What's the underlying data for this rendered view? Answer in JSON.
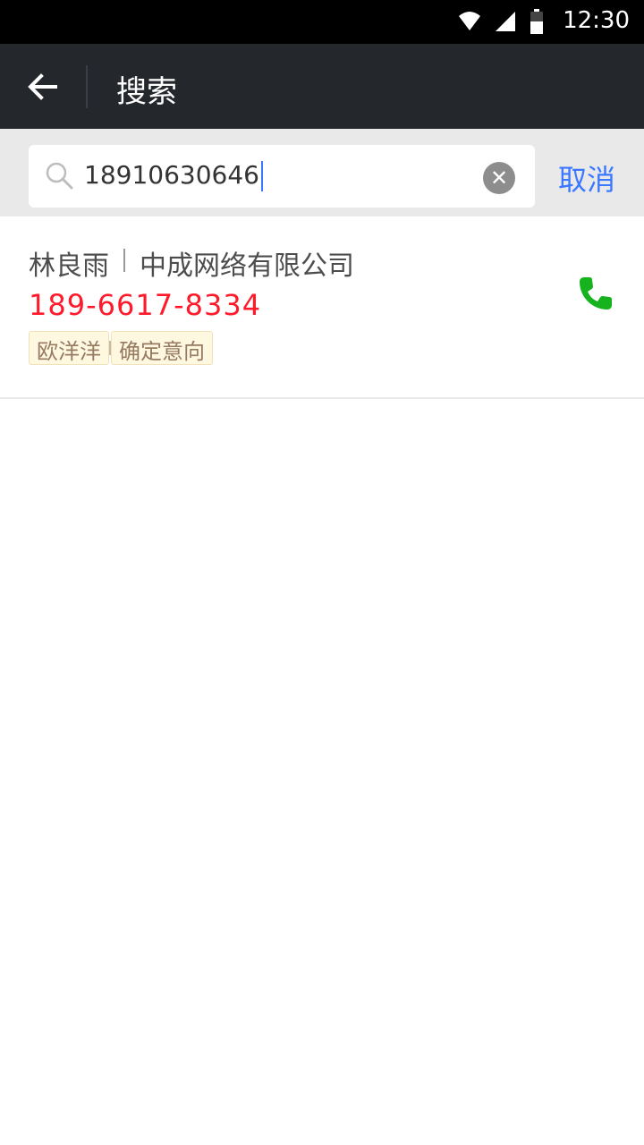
{
  "status_bar": {
    "time": "12:30",
    "icons": [
      "wifi-icon",
      "signal-icon",
      "battery-icon"
    ]
  },
  "app_bar": {
    "title": "搜索",
    "back_icon": "back-arrow-icon"
  },
  "search": {
    "query": "18910630646",
    "cancel_label": "取消",
    "icon": "search-icon",
    "clear_icon": "clear-icon",
    "accent_color": "#3B77FF"
  },
  "results": [
    {
      "name": "林良雨",
      "company": "中成网络有限公司",
      "phone": "189-6617-8334",
      "tags": [
        "欧洋洋",
        "确定意向"
      ],
      "call_icon": "phone-icon",
      "colors": {
        "name": "#4D4D4D",
        "phone": "#FE1A2A",
        "tag_text": "#977A62",
        "tag_bg": "#FFF8E1",
        "divider": "#EAEAEA"
      }
    }
  ]
}
